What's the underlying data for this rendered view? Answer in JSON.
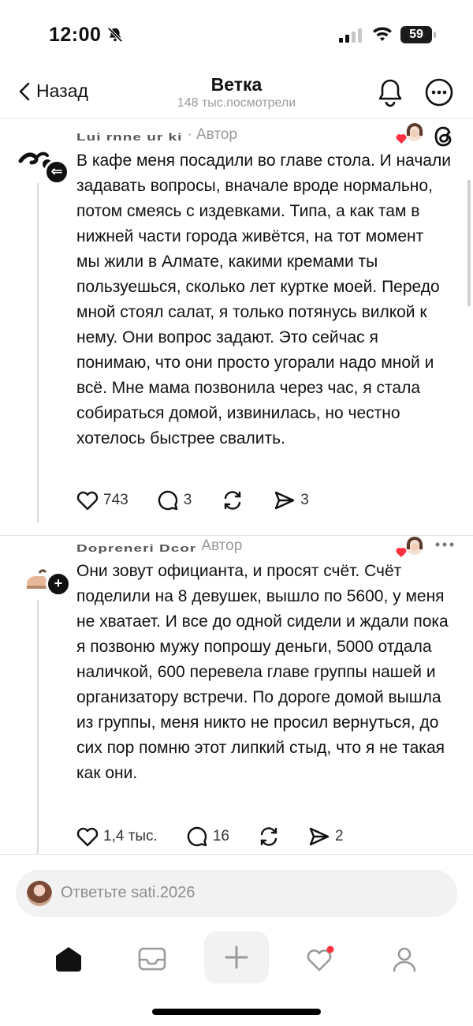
{
  "status_bar": {
    "time": "12:00",
    "battery": "59"
  },
  "header": {
    "back_label": "Назад",
    "title": "Ветка",
    "subtitle": "148 тыс.посмотрели"
  },
  "posts": [
    {
      "author": "sati.2026",
      "author_obscured": "Lui rnne ur ki",
      "author_tag": "· Автор",
      "body": "В кафе меня посадили во главе стола. И начали задавать вопросы, вначале вроде нормально, потом смеясь с издевками. Типа, а как там в нижней части города живётся, на тот момент мы жили в Алмате, какими кремами ты пользуешься, сколько лет куртке моей. Передо мной стоял салат, я только потянусь вилкой к нему. Они вопрос задают. Это сейчас я понимаю, что они просто угорали надо мной и всё. Мне мама позвонила через час, я стала собираться домой, извинилась, но честно хотелось быстрее свалить.",
      "likes": "743",
      "comments": "3",
      "reposts": "",
      "shares": "3"
    },
    {
      "author_obscured": "Dopreneri Dcor",
      "author_tag": "Автор",
      "body": "Они зовут официанта, и просят счёт. Счёт поделили на 8 девушек, вышло по 5600, у меня не хватает. И все до одной сидели и ждали пока я позвоню мужу попрошу деньги, 5000 отдала наличкой, 600 перевела главе группы нашей и организатору встречи. По дороге  домой вышла из группы, меня никто не просил вернуться, до сих пор помню этот липкий стыд, что я не такая как они.",
      "likes": "1,4 тыс.",
      "comments": "16",
      "reposts": "",
      "shares": "2"
    }
  ],
  "reply_box": {
    "placeholder": "Ответьте sati.2026"
  },
  "tabs": [
    "home-icon",
    "inbox-icon",
    "create-icon",
    "activity-icon",
    "profile-icon"
  ],
  "colors": {
    "accent_red": "#ff3040",
    "text": "#111111",
    "muted": "#9a9a9a"
  }
}
